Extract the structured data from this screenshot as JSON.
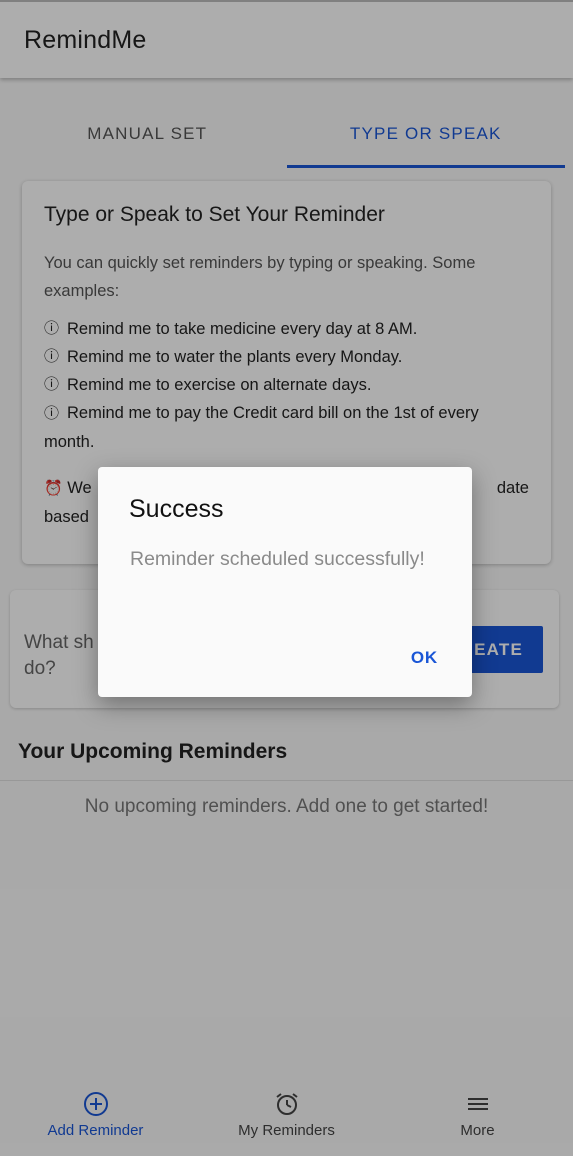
{
  "app_bar": {
    "title": "RemindMe"
  },
  "tabs": [
    {
      "label": "MANUAL SET",
      "active": false
    },
    {
      "label": "TYPE OR SPEAK",
      "active": true
    }
  ],
  "info_card": {
    "title": "Type or Speak to Set Your Reminder",
    "intro": "You can quickly set reminders by typing or speaking. Some examples:",
    "example_icon": "info-circle-icon",
    "examples": [
      "Remind me to take medicine every day at 8 AM.",
      "Remind me to water the plants every Monday.",
      "Remind me to exercise on alternate days.",
      "Remind me to pay the Credit card bill on the 1st of every month."
    ],
    "note_icon": "alarm-clock-icon",
    "note_visible_start": "We",
    "note_visible_end": "date",
    "note_visible_line2": "based"
  },
  "input": {
    "placeholder": "What sh\ndo?",
    "create_label": "EATE"
  },
  "upcoming": {
    "title": "Your Upcoming Reminders",
    "empty_text": "No upcoming reminders. Add one to get started!"
  },
  "bottom_nav": [
    {
      "label": "Add Reminder",
      "icon": "add-circle-icon",
      "active": true
    },
    {
      "label": "My Reminders",
      "icon": "alarm-clock-icon",
      "active": false
    },
    {
      "label": "More",
      "icon": "menu-icon",
      "active": false
    }
  ],
  "dialog": {
    "title": "Success",
    "message": "Reminder scheduled successfully!",
    "ok_label": "OK"
  },
  "colors": {
    "accent": "#1a56d6",
    "scrim": "rgba(0,0,0,0.32)"
  }
}
